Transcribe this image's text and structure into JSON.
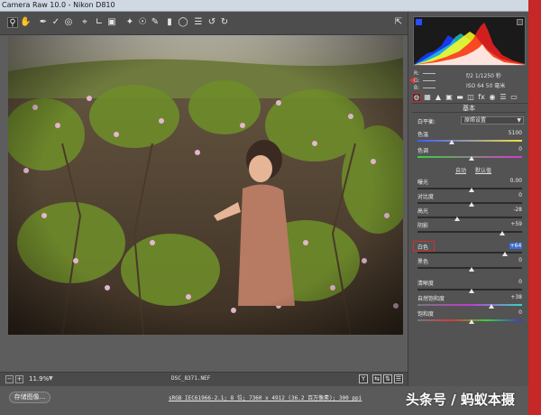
{
  "window": {
    "title": "Camera Raw 10.0 - Nikon D810"
  },
  "toolbar": {
    "tools": [
      "zoom-icon",
      "hand-icon",
      "eyedropper-icon",
      "color-sampler-icon",
      "target-adjust-icon",
      "crop-icon",
      "straighten-icon",
      "transform-icon",
      "spot-removal-icon",
      "red-eye-icon",
      "brush-icon",
      "graduated-filter-icon",
      "radial-filter-icon",
      "preferences-icon",
      "rotate-left-icon",
      "rotate-right-icon"
    ],
    "fullscreen_icon": "fullscreen-icon"
  },
  "exif": {
    "r_label": "R:",
    "g_label": "G:",
    "b_label": "B:",
    "aperture_shutter": "f/2   1/1250 秒",
    "iso_focal": "ISO 64   50 毫米"
  },
  "panel": {
    "title": "基本"
  },
  "basic": {
    "wb_label": "白平衡:",
    "wb_value": "原照设置",
    "temperature": {
      "label": "色温",
      "value": "5100"
    },
    "tint": {
      "label": "色调",
      "value": "0"
    },
    "auto_label": "自动",
    "default_label": "默认值",
    "exposure": {
      "label": "曝光",
      "value": "0.00"
    },
    "contrast": {
      "label": "对比度",
      "value": "0"
    },
    "highlights": {
      "label": "高光",
      "value": "-28"
    },
    "shadows": {
      "label": "阴影",
      "value": "+59"
    },
    "whites": {
      "label": "白色",
      "value": "+64"
    },
    "blacks": {
      "label": "黑色",
      "value": "0"
    },
    "clarity": {
      "label": "清晰度",
      "value": "0"
    },
    "vibrance": {
      "label": "自然饱和度",
      "value": "+38"
    },
    "saturation": {
      "label": "饱和度",
      "value": "0"
    }
  },
  "status": {
    "zoom": "11.9%",
    "filename": "DSC_8371.NEF"
  },
  "bottom": {
    "save_label": "存储图像...",
    "workflow": "sRGB IEC61966-2.1; 8 位; 7360 x 4912 (36.2 百万像素); 300 ppi",
    "watermark": "头条号 / 蚂蚁本摄"
  },
  "colors": {
    "accent_red": "#c62828",
    "selection_blue": "#3d6bd1"
  }
}
